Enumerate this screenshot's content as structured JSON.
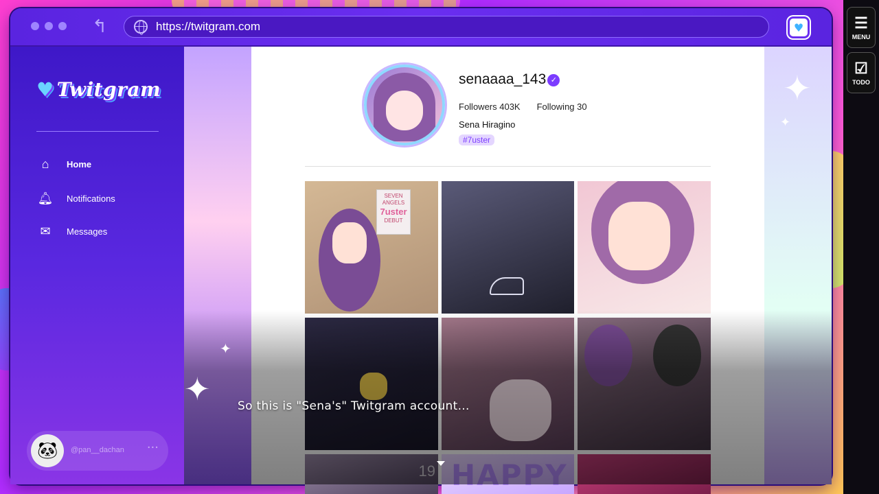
{
  "browser": {
    "url": "https://twitgram.com"
  },
  "sidebar": {
    "logo": "Twitgram",
    "nav": [
      {
        "label": "Home",
        "icon": "home-icon"
      },
      {
        "label": "Notifications",
        "icon": "bell-icon"
      },
      {
        "label": "Messages",
        "icon": "mail-icon"
      }
    ],
    "user": {
      "handle": "@pan__dachan",
      "more": "···"
    }
  },
  "profile": {
    "username": "senaaaa_143",
    "followers": "Followers 403K",
    "following": "Following 30",
    "display_name": "Sena Hiragino",
    "tag": "#7uster"
  },
  "posts": {
    "poster_top": "SEVEN ANGELS",
    "poster_brand": "7uster",
    "poster_bottom": "DEBUT",
    "happy": "HAPPY",
    "number": "19"
  },
  "dialogue": {
    "text": "So this is \"Sena's\" Twitgram account..."
  },
  "rail": {
    "menu": "MENU",
    "todo": "TODO"
  }
}
